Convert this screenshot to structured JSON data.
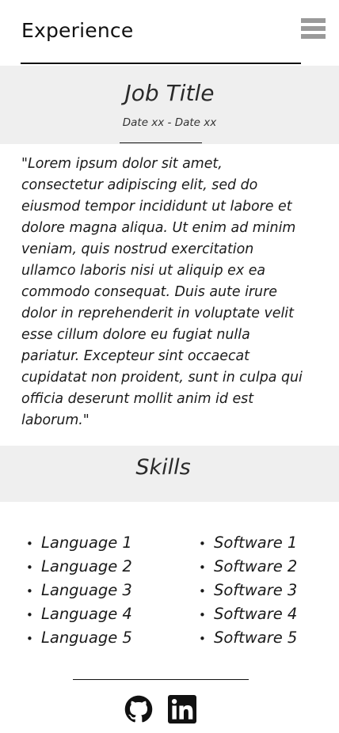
{
  "header": {
    "title": "Experience"
  },
  "job": {
    "title": "Job Title",
    "dates": "Date xx - Date xx",
    "description": "\"Lorem ipsum dolor sit amet, consectetur adipiscing elit, sed do eiusmod tempor incididunt ut labore et dolore magna aliqua. Ut enim ad minim veniam, quis nostrud exercitation ullamco laboris nisi ut aliquip ex ea commodo consequat. Duis aute irure dolor in reprehenderit in voluptate velit esse cillum dolore eu fugiat nulla pariatur. Excepteur sint occaecat cupidatat non proident, sunt in culpa qui officia deserunt mollit anim id est laborum.\""
  },
  "skills": {
    "title": "Skills",
    "languages": [
      "Language 1",
      "Language 2",
      "Language 3",
      "Language 4",
      "Language 5"
    ],
    "software": [
      "Software 1",
      "Software 2",
      "Software 3",
      "Software 4",
      "Software 5"
    ]
  },
  "icons": {
    "menu": "hamburger-menu-icon",
    "github": "github-icon",
    "linkedin": "linkedin-icon"
  },
  "colors": {
    "band_background": "#efefef",
    "menu_icon": "#9a9a9a",
    "text": "#1a1a1a"
  }
}
